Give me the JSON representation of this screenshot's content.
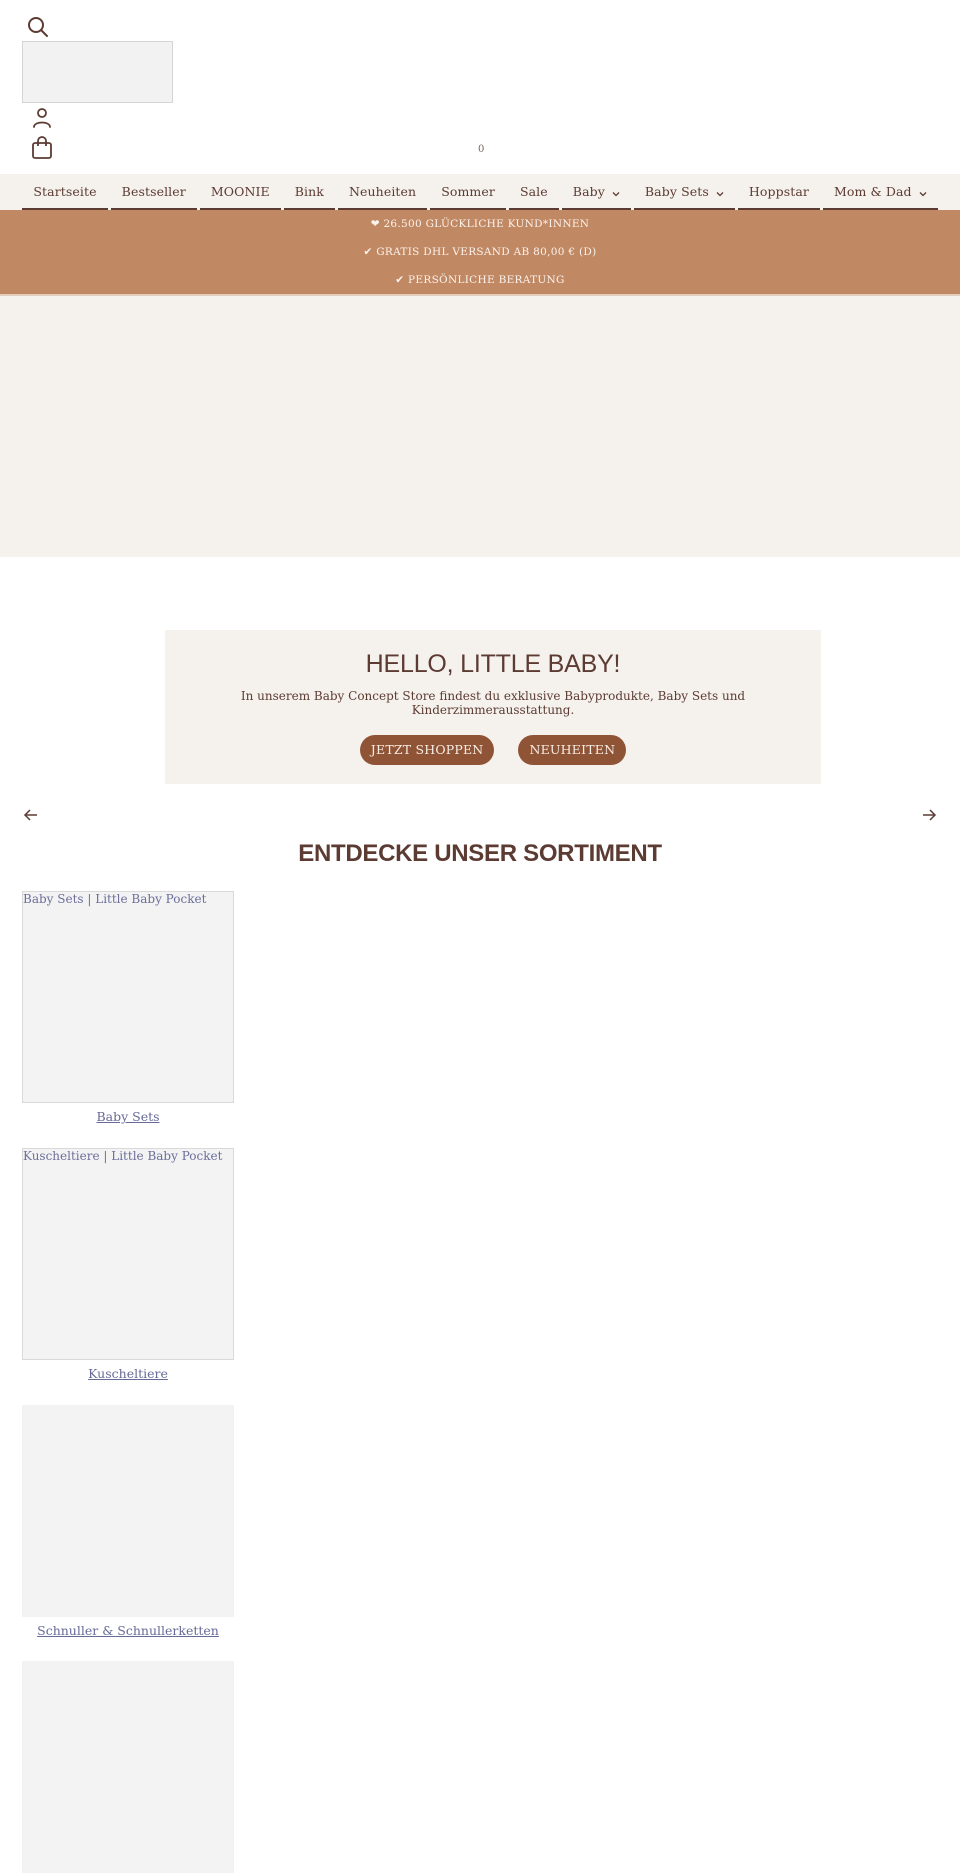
{
  "header": {
    "search_icon": "search-icon",
    "account_icon": "account-icon",
    "cart_icon": "shopping-bag-icon",
    "cart_count": "0"
  },
  "nav": {
    "items": [
      {
        "label": "Startseite",
        "dropdown": false
      },
      {
        "label": "Bestseller",
        "dropdown": false
      },
      {
        "label": "MOONIE",
        "dropdown": false
      },
      {
        "label": "Bink",
        "dropdown": false
      },
      {
        "label": "Neuheiten",
        "dropdown": false
      },
      {
        "label": "Sommer",
        "dropdown": false
      },
      {
        "label": "Sale",
        "dropdown": false
      },
      {
        "label": "Baby",
        "dropdown": true
      },
      {
        "label": "Baby Sets",
        "dropdown": true
      },
      {
        "label": "Hoppstar",
        "dropdown": false
      },
      {
        "label": "Mom & Dad",
        "dropdown": true
      }
    ]
  },
  "usp": {
    "lines": [
      "❤ 26.500 GLÜCKLICHE KUND*INNEN",
      "✔ GRATIS DHL VERSAND AB 80,00 € (D)",
      "✔ PERSÖNLICHE BERATUNG"
    ]
  },
  "welcome": {
    "title": "HELLO, LITTLE BABY!",
    "text": "In unserem Baby Concept Store findest du exklusive Babyprodukte, Baby Sets und Kinderzimmerausstattung.",
    "buttons": [
      "JETZT SHOPPEN",
      "NEUHEITEN"
    ]
  },
  "carousel": {
    "prev_icon": "arrow-left-icon",
    "next_icon": "arrow-right-icon"
  },
  "categories": {
    "title": "ENTDECKE UNSER SORTIMENT",
    "items": [
      {
        "alt": "Baby Sets | Little Baby Pocket",
        "label": "Baby Sets"
      },
      {
        "alt": "Kuscheltiere | Little Baby Pocket",
        "label": "Kuscheltiere"
      },
      {
        "alt": "",
        "label": "Schnuller & Schnullerketten"
      },
      {
        "alt": "",
        "label": ""
      }
    ]
  },
  "colors": {
    "text_brown": "#5c3b33",
    "nav_bg": "#f5f1ed",
    "usp_bg": "#c18864",
    "button_bg": "#8f5436",
    "link_color": "#666a96"
  }
}
